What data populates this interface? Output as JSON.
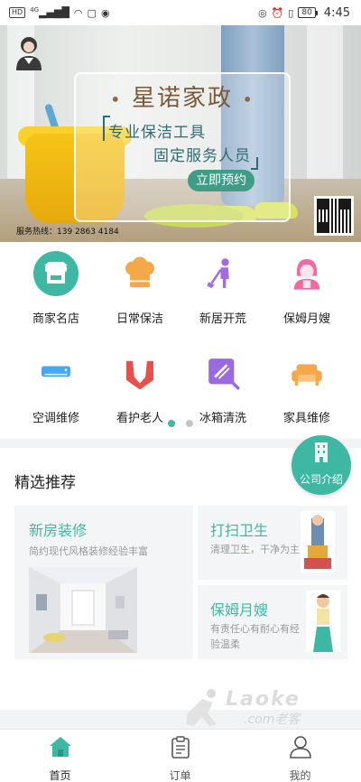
{
  "status_bar": {
    "left_chips": [
      "HD",
      "4G"
    ],
    "battery": "80",
    "time": "4:45"
  },
  "banner": {
    "title": "星诺家政",
    "line1": "专业保洁工具",
    "line2": "固定服务人员",
    "book_label": "立即预约",
    "hotline": "服务热线：139 2863 4184"
  },
  "categories": [
    {
      "label": "商家名店",
      "icon": "storefront-icon"
    },
    {
      "label": "日常保洁",
      "icon": "chef-hat-icon"
    },
    {
      "label": "新居开荒",
      "icon": "cleaner-icon"
    },
    {
      "label": "保姆月嫂",
      "icon": "nanny-icon"
    },
    {
      "label": "空调维修",
      "icon": "air-conditioner-icon"
    },
    {
      "label": "看护老人",
      "icon": "caring-hands-icon"
    },
    {
      "label": "冰箱清洗",
      "icon": "fridge-clean-icon"
    },
    {
      "label": "家具维修",
      "icon": "sofa-icon"
    }
  ],
  "pager": {
    "count": 2,
    "active": 0
  },
  "recommend": {
    "title": "精选推荐",
    "company_label": "公司介绍",
    "cards": [
      {
        "title": "新房装修",
        "subtitle": "简约现代风格装修经验丰富"
      },
      {
        "title": "打扫卫生",
        "subtitle": "清理卫生，干净为主"
      },
      {
        "title": "保姆月嫂",
        "subtitle": "有责任心有耐心有经验温柔"
      }
    ]
  },
  "watermark": {
    "text": "Laoke",
    "sub": ".com老客"
  },
  "bottom_nav": [
    {
      "label": "首页",
      "icon": "home-icon",
      "active": true
    },
    {
      "label": "订单",
      "icon": "order-clipboard-icon",
      "active": false
    },
    {
      "label": "我的",
      "icon": "profile-icon",
      "active": false
    }
  ],
  "colors": {
    "accent": "#3fb8a3",
    "text": "#222222",
    "muted": "#9a9a9a"
  }
}
